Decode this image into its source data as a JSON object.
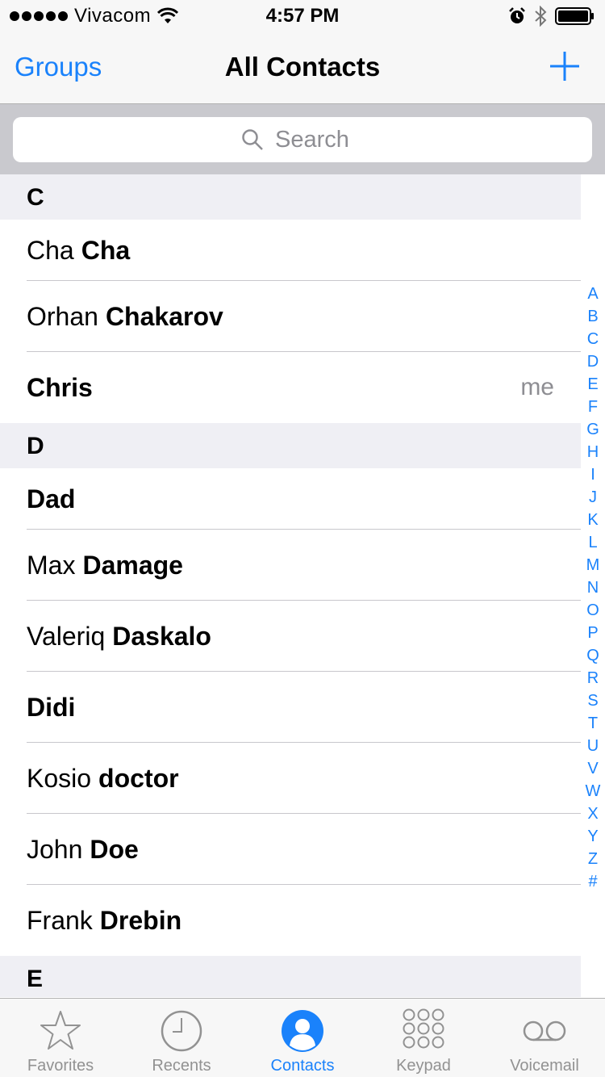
{
  "status_bar": {
    "carrier": "Vivacom",
    "time": "4:57 PM",
    "signal_bars": 5
  },
  "nav": {
    "left_label": "Groups",
    "title": "All Contacts",
    "add_icon": "plus-icon"
  },
  "search": {
    "placeholder": "Search"
  },
  "sections": [
    {
      "letter": "C",
      "contacts": [
        {
          "first": "Cha",
          "last": "Cha",
          "tag": ""
        },
        {
          "first": "Orhan",
          "last": "Chakarov",
          "tag": ""
        },
        {
          "first": "",
          "last": "Chris",
          "tag": "me"
        }
      ]
    },
    {
      "letter": "D",
      "contacts": [
        {
          "first": "",
          "last": "Dad",
          "tag": ""
        },
        {
          "first": "Max",
          "last": "Damage",
          "tag": ""
        },
        {
          "first": "Valeriq",
          "last": "Daskalo",
          "tag": ""
        },
        {
          "first": "",
          "last": "Didi",
          "tag": ""
        },
        {
          "first": "Kosio",
          "last": "doctor",
          "tag": ""
        },
        {
          "first": "John",
          "last": "Doe",
          "tag": ""
        },
        {
          "first": "Frank",
          "last": "Drebin",
          "tag": ""
        }
      ]
    },
    {
      "letter": "E",
      "contacts": []
    }
  ],
  "index_letters": [
    "A",
    "B",
    "C",
    "D",
    "E",
    "F",
    "G",
    "H",
    "I",
    "J",
    "K",
    "L",
    "M",
    "N",
    "O",
    "P",
    "Q",
    "R",
    "S",
    "T",
    "U",
    "V",
    "W",
    "X",
    "Y",
    "Z",
    "#"
  ],
  "tabs": [
    {
      "label": "Favorites",
      "icon": "star-icon",
      "active": false
    },
    {
      "label": "Recents",
      "icon": "clock-icon",
      "active": false
    },
    {
      "label": "Contacts",
      "icon": "person-icon",
      "active": true
    },
    {
      "label": "Keypad",
      "icon": "keypad-icon",
      "active": false
    },
    {
      "label": "Voicemail",
      "icon": "voicemail-icon",
      "active": false
    }
  ],
  "colors": {
    "accent": "#1a82fb",
    "inactive": "#929292",
    "section_bg": "#efeff4"
  }
}
